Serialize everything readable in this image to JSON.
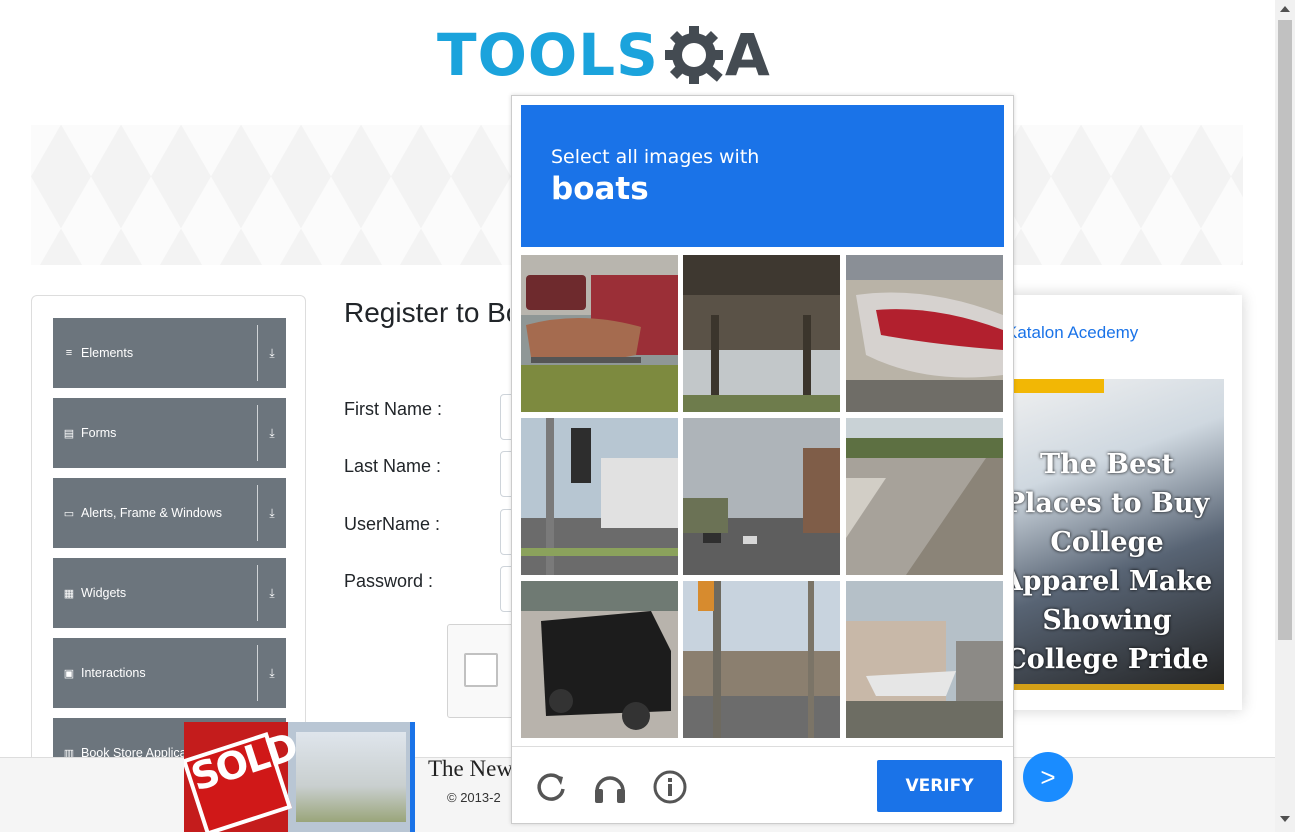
{
  "logo": {
    "text_main": "TOOLS",
    "text_end": "A"
  },
  "sidebar": {
    "groups": [
      {
        "label": "Elements",
        "icon": "list-icon"
      },
      {
        "label": "Forms",
        "icon": "form-icon"
      },
      {
        "label": "Alerts, Frame & Windows",
        "icon": "window-icon"
      },
      {
        "label": "Widgets",
        "icon": "widgets-icon"
      },
      {
        "label": "Interactions",
        "icon": "interaction-icon"
      },
      {
        "label": "Book Store Applica",
        "icon": "chart-icon"
      }
    ]
  },
  "form": {
    "title": "Register to Book Store",
    "first_name_label": "First Name :",
    "last_name_label": "Last Name :",
    "username_label": "UserName :",
    "password_label": "Password :"
  },
  "right_ad": {
    "link": "Katalon Acedemy",
    "headline": "The Best Places to Buy College Apparel Make Showing College Pride Too Easy"
  },
  "bottom_ad": {
    "title": "The New",
    "copyright": "© 2013-2",
    "sign_text": "SOLD",
    "next": ">"
  },
  "captcha": {
    "prompt": "Select all images with",
    "target": "boats",
    "verify_label": "VERIFY",
    "accent": "#1a73e8",
    "tiles": [
      "boat-on-trailer-driveway",
      "underside-of-bridge",
      "speedboat-on-trailer",
      "traffic-light-street",
      "city-street-intersection",
      "sidewalk-crosswalk",
      "black-suv-parked",
      "street-with-traffic-signals",
      "boat-on-trailer-by-house"
    ]
  }
}
